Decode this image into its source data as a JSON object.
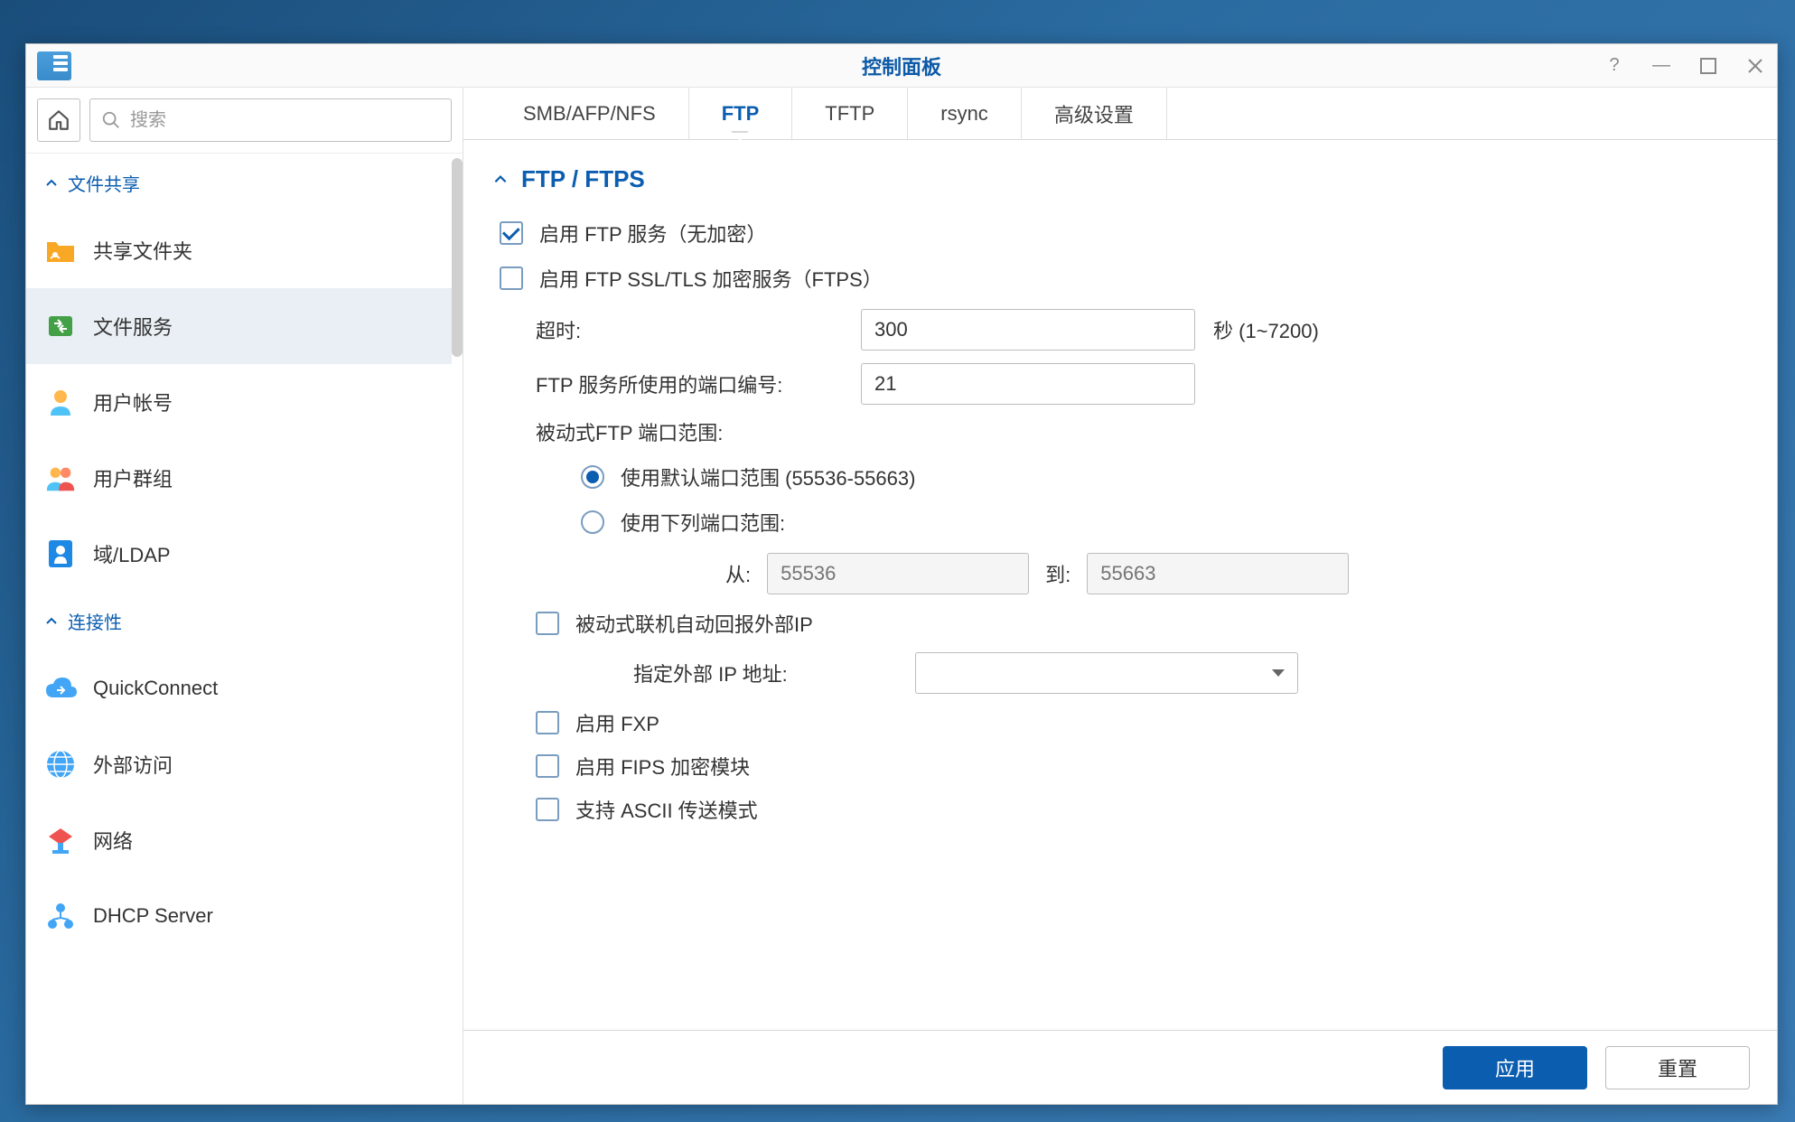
{
  "window": {
    "title": "控制面板"
  },
  "search": {
    "placeholder": "搜索"
  },
  "sidebar": {
    "sections": [
      {
        "title": "文件共享",
        "items": [
          {
            "id": "shared-folder",
            "label": "共享文件夹"
          },
          {
            "id": "file-services",
            "label": "文件服务"
          },
          {
            "id": "user",
            "label": "用户帐号"
          },
          {
            "id": "group",
            "label": "用户群组"
          },
          {
            "id": "domain-ldap",
            "label": "域/LDAP"
          }
        ]
      },
      {
        "title": "连接性",
        "items": [
          {
            "id": "quickconnect",
            "label": "QuickConnect"
          },
          {
            "id": "external-access",
            "label": "外部访问"
          },
          {
            "id": "network",
            "label": "网络"
          },
          {
            "id": "dhcp",
            "label": "DHCP Server"
          }
        ]
      }
    ]
  },
  "tabs": [
    {
      "id": "smb",
      "label": "SMB/AFP/NFS"
    },
    {
      "id": "ftp",
      "label": "FTP"
    },
    {
      "id": "tftp",
      "label": "TFTP"
    },
    {
      "id": "rsync",
      "label": "rsync"
    },
    {
      "id": "advanced",
      "label": "高级设置"
    }
  ],
  "section": {
    "title": "FTP / FTPS"
  },
  "ftp": {
    "enable_ftp_label": "启用 FTP 服务（无加密）",
    "enable_ftps_label": "启用 FTP SSL/TLS 加密服务（FTPS）",
    "timeout_label": "超时:",
    "timeout_value": "300",
    "timeout_hint": "秒 (1~7200)",
    "port_label": "FTP 服务所使用的端口编号:",
    "port_value": "21",
    "passive_label": "被动式FTP 端口范围:",
    "radio_default_label": "使用默认端口范围 (55536-55663)",
    "radio_custom_label": "使用下列端口范围:",
    "from_label": "从:",
    "from_placeholder": "55536",
    "to_label": "到:",
    "to_placeholder": "55663",
    "report_ext_ip_label": "被动式联机自动回报外部IP",
    "ext_ip_label": "指定外部 IP 地址:",
    "enable_fxp_label": "启用 FXP",
    "enable_fips_label": "启用 FIPS 加密模块",
    "ascii_label": "支持 ASCII 传送模式"
  },
  "footer": {
    "apply": "应用",
    "reset": "重置"
  }
}
